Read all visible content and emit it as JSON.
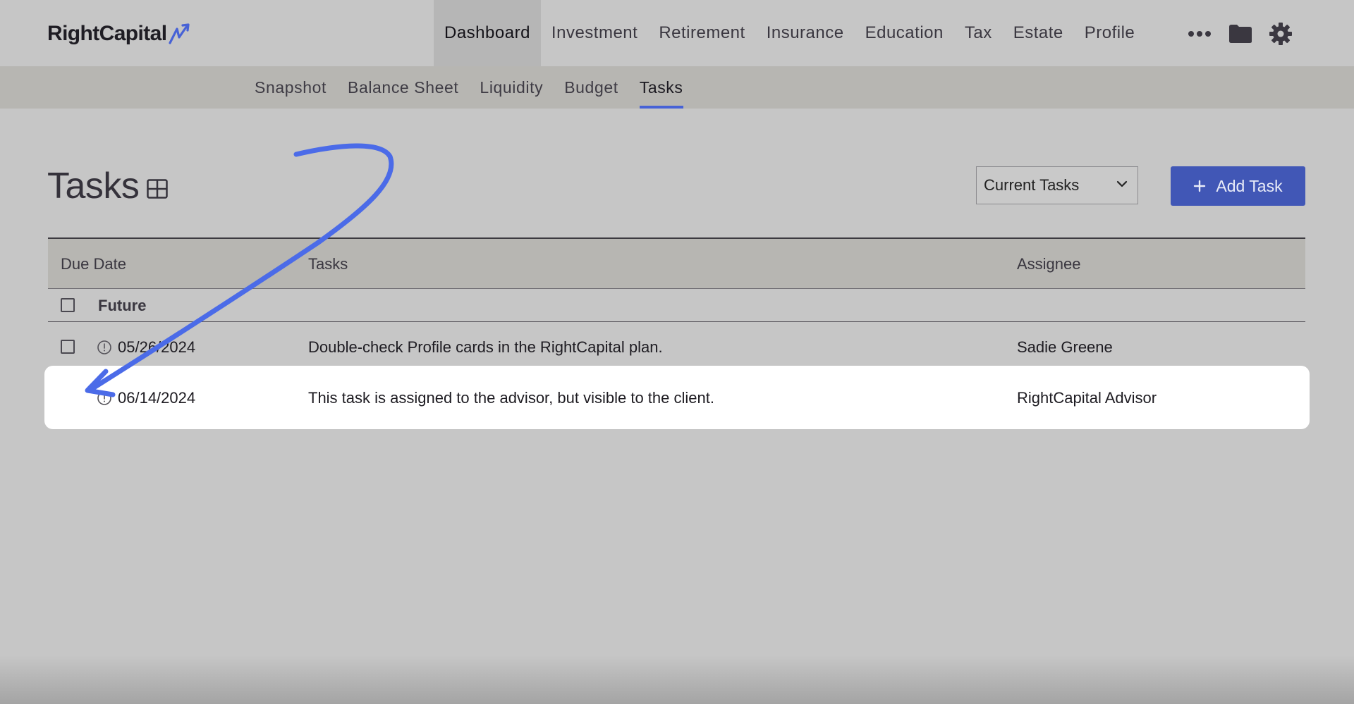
{
  "app": {
    "logo_text": "RightCapital",
    "brand_color": "#4762d6"
  },
  "main_nav": [
    {
      "label": "Dashboard",
      "active": true
    },
    {
      "label": "Investment",
      "active": false
    },
    {
      "label": "Retirement",
      "active": false
    },
    {
      "label": "Insurance",
      "active": false
    },
    {
      "label": "Education",
      "active": false
    },
    {
      "label": "Tax",
      "active": false
    },
    {
      "label": "Estate",
      "active": false
    },
    {
      "label": "Profile",
      "active": false
    }
  ],
  "top_icons": [
    "more-icon",
    "folder-icon",
    "gear-icon"
  ],
  "sub_nav": [
    {
      "label": "Snapshot",
      "active": false
    },
    {
      "label": "Balance Sheet",
      "active": false
    },
    {
      "label": "Liquidity",
      "active": false
    },
    {
      "label": "Budget",
      "active": false
    },
    {
      "label": "Tasks",
      "active": true
    }
  ],
  "page": {
    "title": "Tasks",
    "title_icon": "grid-icon",
    "filter_select": {
      "value": "Current Tasks"
    },
    "add_button": {
      "label": "Add Task",
      "icon": "plus-icon"
    }
  },
  "table": {
    "headers": {
      "due_date": "Due Date",
      "tasks": "Tasks",
      "assignee": "Assignee"
    },
    "group": {
      "label": "Future"
    },
    "rows": [
      {
        "due_date": "05/26/2024",
        "task": "Double-check Profile cards in the RightCapital plan.",
        "assignee": "Sadie Greene",
        "has_checkbox": true,
        "icon": "clock-icon"
      },
      {
        "due_date": "06/14/2024",
        "task": "This task is assigned to the advisor, but visible to the client.",
        "assignee": "RightCapital Advisor",
        "has_checkbox": false,
        "icon": "clock-icon",
        "highlighted": true
      }
    ]
  },
  "annotation": {
    "type": "arrow",
    "color": "#4b6be8"
  }
}
